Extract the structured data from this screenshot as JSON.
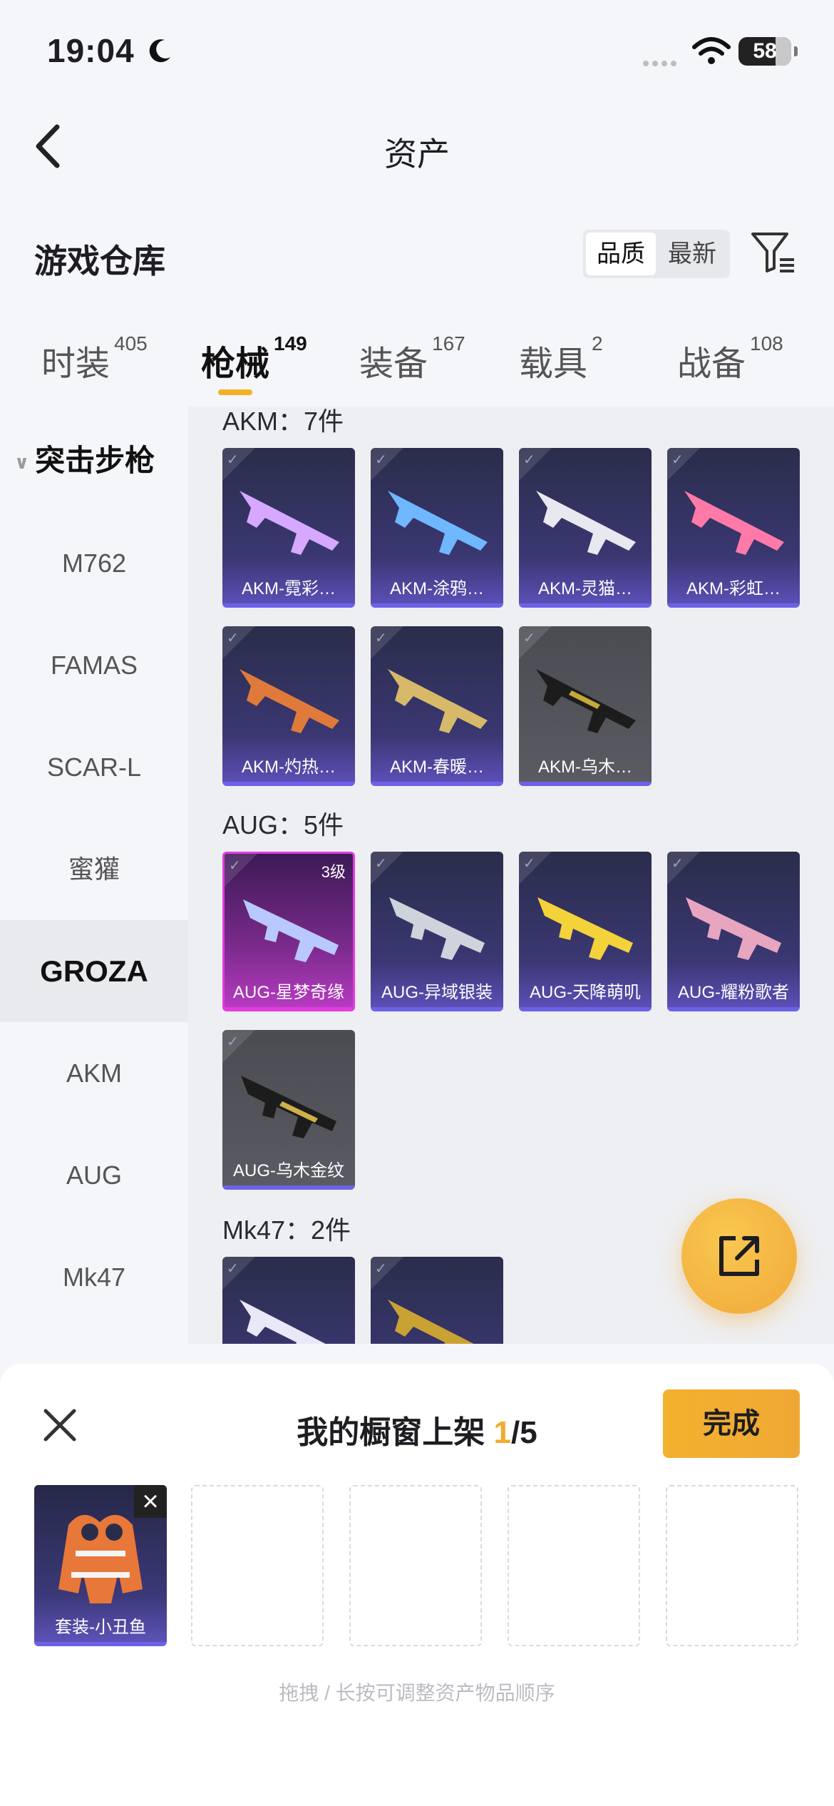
{
  "status": {
    "time": "19:04",
    "battery": "58"
  },
  "header": {
    "title": "资产"
  },
  "section": {
    "title": "游戏仓库",
    "sort_quality": "品质",
    "sort_newest": "最新"
  },
  "tabs": [
    {
      "label": "时装",
      "count": "405"
    },
    {
      "label": "枪械",
      "count": "149"
    },
    {
      "label": "装备",
      "count": "167"
    },
    {
      "label": "载具",
      "count": "2"
    },
    {
      "label": "战备",
      "count": "108"
    }
  ],
  "sidebar": {
    "group": "突击步枪",
    "items": [
      "M762",
      "FAMAS",
      "SCAR-L",
      "蜜獾",
      "GROZA",
      "AKM",
      "AUG",
      "Mk47"
    ],
    "active": "GROZA"
  },
  "groups": [
    {
      "label": "AKM：7件",
      "items": [
        {
          "name": "AKM-霓彩…",
          "color": "#d6a8ff"
        },
        {
          "name": "AKM-涂鸦…",
          "color": "#6fb7ff"
        },
        {
          "name": "AKM-灵猫…",
          "color": "#e8e8f0"
        },
        {
          "name": "AKM-彩虹…",
          "color": "#ff7aa8"
        },
        {
          "name": "AKM-灼热…",
          "color": "#e07a3a"
        },
        {
          "name": "AKM-春暖…",
          "color": "#d7b96a"
        },
        {
          "name": "AKM-乌木…",
          "color": "#c8a83a"
        }
      ]
    },
    {
      "label": "AUG：5件",
      "items": [
        {
          "name": "AUG-星梦奇缘",
          "color": "#b9c8ff",
          "level": "3级"
        },
        {
          "name": "AUG-异域银装",
          "color": "#cfd3dc"
        },
        {
          "name": "AUG-天降萌叽",
          "color": "#f4d23a"
        },
        {
          "name": "AUG-耀粉歌者",
          "color": "#e8a5c0"
        },
        {
          "name": "AUG-乌木金纹",
          "color": "#d0b04a"
        }
      ]
    },
    {
      "label": "Mk47：2件",
      "items": [
        {
          "name": "",
          "color": "#e8e8f8"
        },
        {
          "name": "",
          "color": "#c9a234"
        }
      ]
    }
  ],
  "sheet": {
    "title_prefix": "我的橱窗上架 ",
    "count": "1",
    "total": "/5",
    "done": "完成",
    "slot_item": "套装-小丑鱼",
    "hint": "拖拽 / 长按可调整资产物品顺序"
  },
  "colors": {
    "accent": "#f3b128",
    "purple_border": "#6c62e8",
    "pink_border": "#e23ce0"
  }
}
